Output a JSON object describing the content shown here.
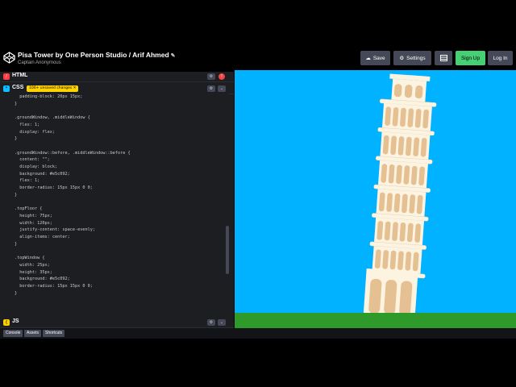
{
  "header": {
    "title": "Pisa Tower by One Person Studio / Arif Ahmed",
    "subtitle": "Captain Anonymous",
    "buttons": {
      "save": "Save",
      "settings": "Settings",
      "signup": "Sign Up",
      "login": "Log In"
    }
  },
  "panes": {
    "html": {
      "label": "HTML"
    },
    "css": {
      "label": "CSS",
      "unsaved": "100+ unsaved changes ✕"
    },
    "js": {
      "label": "JS"
    }
  },
  "code_lines": [
    {
      "n": "",
      "t": "  padding-block: 20px 15px;"
    },
    {
      "n": "",
      "t": "}"
    },
    {
      "n": "",
      "t": ""
    },
    {
      "n": "",
      "t": ".groundWindow, .middleWindow {"
    },
    {
      "n": "",
      "t": "  flex: 1;"
    },
    {
      "n": "",
      "t": "  display: flex;"
    },
    {
      "n": "",
      "t": "}"
    },
    {
      "n": "",
      "t": ""
    },
    {
      "n": "",
      "t": ".groundWindow::before, .middleWindow::before {"
    },
    {
      "n": "",
      "t": "  content: \"\";"
    },
    {
      "n": "",
      "t": "  display: block;"
    },
    {
      "n": "",
      "t": "  background: #e5c092;"
    },
    {
      "n": "",
      "t": "  flex: 1;"
    },
    {
      "n": "",
      "t": "  border-radius: 15px 15px 0 0;"
    },
    {
      "n": "",
      "t": "}"
    },
    {
      "n": "",
      "t": ""
    },
    {
      "n": "",
      "t": ".topFloor {"
    },
    {
      "n": "",
      "t": "  height: 75px;"
    },
    {
      "n": "",
      "t": "  width: 120px;"
    },
    {
      "n": "",
      "t": "  justify-content: space-evenly;"
    },
    {
      "n": "",
      "t": "  align-items: center;"
    },
    {
      "n": "",
      "t": "}"
    },
    {
      "n": "",
      "t": ""
    },
    {
      "n": "",
      "t": ".topWindow {"
    },
    {
      "n": "",
      "t": "  width: 25px;"
    },
    {
      "n": "",
      "t": "  height: 35px;"
    },
    {
      "n": "",
      "t": "  background: #e5c092;"
    },
    {
      "n": "",
      "t": "  border-radius: 15px 15px 0 0;"
    },
    {
      "n": "",
      "t": "}"
    },
    {
      "n": "",
      "t": ""
    }
  ],
  "footer": {
    "console": "Console",
    "assets": "Assets",
    "shortcuts": "Shortcuts"
  },
  "colors": {
    "sky": "#00b2ff",
    "ground": "#2e9a29",
    "tower_light": "#fdf3e1",
    "tower_window": "#e5c092",
    "signup": "#47cf73"
  }
}
